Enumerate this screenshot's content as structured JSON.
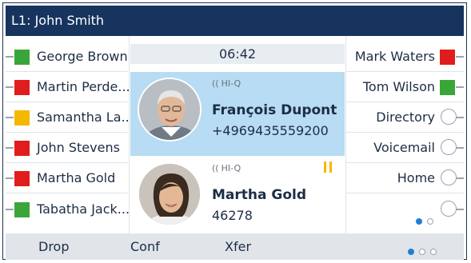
{
  "title": "L1: John Smith",
  "timer": "06:42",
  "left_keys": [
    {
      "label": "George Brown",
      "status": "green"
    },
    {
      "label": "Martin Perde...",
      "status": "red"
    },
    {
      "label": "Samantha La...",
      "status": "yellow"
    },
    {
      "label": "John Stevens",
      "status": "red"
    },
    {
      "label": "Martha Gold",
      "status": "red"
    },
    {
      "label": "Tabatha Jack...",
      "status": "green"
    }
  ],
  "right_keys": [
    {
      "label": "Mark Waters",
      "status": "red"
    },
    {
      "label": "Tom Wilson",
      "status": "green"
    },
    {
      "label": "Directory",
      "status": "none"
    },
    {
      "label": "Voicemail",
      "status": "none"
    },
    {
      "label": "Home",
      "status": "none"
    }
  ],
  "calls": [
    {
      "hd": "HI-Q",
      "name": "François Dupont",
      "number": "+4969435559200",
      "state": "active"
    },
    {
      "hd": "HI-Q",
      "name": "Martha Gold",
      "number": "46278",
      "state": "held"
    }
  ],
  "softkeys": [
    "Drop",
    "Conf",
    "Xfer"
  ],
  "key_pages": {
    "count": 2,
    "current": 1
  },
  "softkey_pages": {
    "count": 3,
    "current": 1
  },
  "colors": {
    "title_bg": "#16345e",
    "active_call_bg": "#b7dcf3",
    "green": "#3aa63a",
    "red": "#e11c1c",
    "yellow": "#f4b800",
    "softkey_bg": "#e1e5ea"
  },
  "icons": {
    "hd_audio": "hd-audio-icon",
    "hold": "hold-icon",
    "avatar": "contact-avatar-icon"
  }
}
